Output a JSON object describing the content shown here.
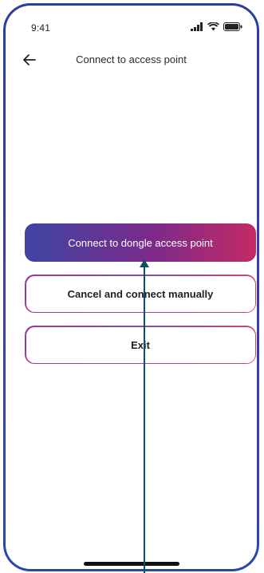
{
  "status_bar": {
    "time": "9:41",
    "icons": [
      "signal-icon",
      "wifi-icon",
      "battery-icon"
    ]
  },
  "header": {
    "back_icon": "back-arrow-icon",
    "title": "Connect to access point"
  },
  "actions": {
    "primary_label": "Connect to dongle access point",
    "cancel_label": "Cancel and connect manually",
    "exit_label": "Exit"
  },
  "colors": {
    "frame": "#2b3f9a",
    "gradient_start": "#3f45a3",
    "gradient_mid": "#7b2a8a",
    "gradient_end": "#c42a64",
    "annotation_arrow": "#0d4f68"
  }
}
